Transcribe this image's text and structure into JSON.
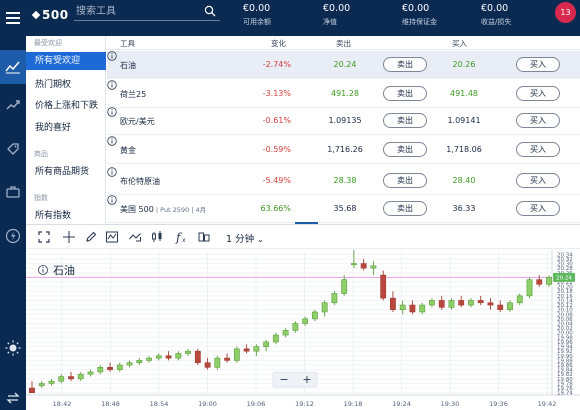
{
  "topbar": {
    "brand": "500",
    "search_placeholder": "搜索工具",
    "stats": [
      {
        "value": "€0.00",
        "label": "可用余额"
      },
      {
        "value": "€0.00",
        "label": "净值"
      },
      {
        "value": "€0.00",
        "label": "维持保证金"
      },
      {
        "value": "€0.00",
        "label": "收益/损失"
      }
    ],
    "avatar": "13"
  },
  "categories": {
    "group1": "最受欢迎",
    "items1": [
      "所有受欢迎",
      "热门期权",
      "价格上涨和下跌",
      "我的喜好"
    ],
    "group2": "商品",
    "items2": [
      "所有商品期货"
    ],
    "group3": "指数",
    "items3": [
      "所有指数"
    ]
  },
  "table": {
    "headers": {
      "tool": "工具",
      "change": "变化",
      "sell": "卖出",
      "buy": "买入"
    },
    "sell_label": "卖出",
    "buy_label": "买入",
    "rows": [
      {
        "name": "石油",
        "sub": "",
        "change": "-2.74%",
        "sell": "20.24",
        "buy": "20.26",
        "trend": "neg",
        "price_color": "pos"
      },
      {
        "name": "荷兰25",
        "sub": "",
        "change": "-3.13%",
        "sell": "491.28",
        "buy": "491.48",
        "trend": "neg",
        "price_color": "pos"
      },
      {
        "name": "欧元/美元",
        "sub": "",
        "change": "-0.61%",
        "sell": "1.09135",
        "buy": "1.09141",
        "trend": "neg",
        "price_color": "none"
      },
      {
        "name": "黄金",
        "sub": "",
        "change": "-0.59%",
        "sell": "1,716.26",
        "buy": "1,718.06",
        "trend": "neg",
        "price_color": "none"
      },
      {
        "name": "布伦特原油",
        "sub": "",
        "change": "-5.49%",
        "sell": "28.38",
        "buy": "28.40",
        "trend": "neg",
        "price_color": "pos"
      },
      {
        "name": "美国 500",
        "sub": " | Put 2590 | 4月",
        "change": "63.66%",
        "sell": "35.68",
        "buy": "36.33",
        "trend": "pos",
        "price_color": "none"
      }
    ]
  },
  "chart_toolbar": {
    "timeframe": "1 分钟"
  },
  "chart_data": {
    "type": "candlestick",
    "title": "石油",
    "last_price": "20.24",
    "x_ticks": [
      "18:42",
      "18:48",
      "18:54",
      "19:00",
      "19:06",
      "19:12",
      "19:18",
      "19:24",
      "19:30",
      "19:36",
      "19:42"
    ],
    "y_ticks": [
      "20.34",
      "20.32",
      "20.30",
      "20.28",
      "20.26",
      "20.24",
      "20.22",
      "20.20",
      "20.18",
      "20.16",
      "20.14",
      "20.12",
      "20.10",
      "20.08",
      "20.06",
      "20.04",
      "20.02",
      "20.00",
      "19.98",
      "19.96",
      "19.94",
      "19.92",
      "19.90",
      "19.88",
      "19.86",
      "19.84",
      "19.82",
      "19.80",
      "19.78",
      "19.76",
      "19.74"
    ],
    "ylim": [
      19.73,
      20.35
    ],
    "candles": [
      {
        "o": 19.76,
        "h": 19.79,
        "l": 19.74,
        "c": 19.74
      },
      {
        "o": 19.77,
        "h": 19.79,
        "l": 19.76,
        "c": 19.78
      },
      {
        "o": 19.78,
        "h": 19.8,
        "l": 19.77,
        "c": 19.79
      },
      {
        "o": 19.79,
        "h": 19.82,
        "l": 19.78,
        "c": 19.81
      },
      {
        "o": 19.81,
        "h": 19.83,
        "l": 19.79,
        "c": 19.8
      },
      {
        "o": 19.8,
        "h": 19.83,
        "l": 19.79,
        "c": 19.82
      },
      {
        "o": 19.82,
        "h": 19.84,
        "l": 19.81,
        "c": 19.83
      },
      {
        "o": 19.83,
        "h": 19.86,
        "l": 19.82,
        "c": 19.85
      },
      {
        "o": 19.85,
        "h": 19.87,
        "l": 19.83,
        "c": 19.84
      },
      {
        "o": 19.84,
        "h": 19.87,
        "l": 19.83,
        "c": 19.86
      },
      {
        "o": 19.86,
        "h": 19.88,
        "l": 19.85,
        "c": 19.87
      },
      {
        "o": 19.87,
        "h": 19.89,
        "l": 19.86,
        "c": 19.88
      },
      {
        "o": 19.88,
        "h": 19.9,
        "l": 19.87,
        "c": 19.89
      },
      {
        "o": 19.89,
        "h": 19.91,
        "l": 19.88,
        "c": 19.9
      },
      {
        "o": 19.9,
        "h": 19.92,
        "l": 19.88,
        "c": 19.89
      },
      {
        "o": 19.89,
        "h": 19.92,
        "l": 19.88,
        "c": 19.91
      },
      {
        "o": 19.91,
        "h": 19.93,
        "l": 19.9,
        "c": 19.92
      },
      {
        "o": 19.92,
        "h": 19.93,
        "l": 19.86,
        "c": 19.87
      },
      {
        "o": 19.87,
        "h": 19.89,
        "l": 19.84,
        "c": 19.85
      },
      {
        "o": 19.85,
        "h": 19.9,
        "l": 19.84,
        "c": 19.89
      },
      {
        "o": 19.89,
        "h": 19.91,
        "l": 19.87,
        "c": 19.88
      },
      {
        "o": 19.88,
        "h": 19.94,
        "l": 19.87,
        "c": 19.93
      },
      {
        "o": 19.93,
        "h": 19.95,
        "l": 19.91,
        "c": 19.92
      },
      {
        "o": 19.92,
        "h": 19.95,
        "l": 19.9,
        "c": 19.94
      },
      {
        "o": 19.94,
        "h": 19.97,
        "l": 19.92,
        "c": 19.96
      },
      {
        "o": 19.96,
        "h": 20.0,
        "l": 19.95,
        "c": 19.99
      },
      {
        "o": 19.99,
        "h": 20.02,
        "l": 19.98,
        "c": 20.01
      },
      {
        "o": 20.01,
        "h": 20.05,
        "l": 20.0,
        "c": 20.04
      },
      {
        "o": 20.04,
        "h": 20.07,
        "l": 20.03,
        "c": 20.06
      },
      {
        "o": 20.06,
        "h": 20.1,
        "l": 20.05,
        "c": 20.09
      },
      {
        "o": 20.09,
        "h": 20.14,
        "l": 20.07,
        "c": 20.13
      },
      {
        "o": 20.13,
        "h": 20.18,
        "l": 20.12,
        "c": 20.17
      },
      {
        "o": 20.17,
        "h": 20.25,
        "l": 20.16,
        "c": 20.23
      },
      {
        "o": 20.3,
        "h": 20.36,
        "l": 20.28,
        "c": 20.3
      },
      {
        "o": 20.3,
        "h": 20.32,
        "l": 20.27,
        "c": 20.28
      },
      {
        "o": 20.28,
        "h": 20.31,
        "l": 20.25,
        "c": 20.29
      },
      {
        "o": 20.25,
        "h": 20.27,
        "l": 20.14,
        "c": 20.15
      },
      {
        "o": 20.15,
        "h": 20.18,
        "l": 20.09,
        "c": 20.1
      },
      {
        "o": 20.1,
        "h": 20.14,
        "l": 20.08,
        "c": 20.12
      },
      {
        "o": 20.12,
        "h": 20.14,
        "l": 20.08,
        "c": 20.09
      },
      {
        "o": 20.09,
        "h": 20.13,
        "l": 20.08,
        "c": 20.12
      },
      {
        "o": 20.12,
        "h": 20.15,
        "l": 20.11,
        "c": 20.14
      },
      {
        "o": 20.14,
        "h": 20.16,
        "l": 20.1,
        "c": 20.11
      },
      {
        "o": 20.11,
        "h": 20.15,
        "l": 20.1,
        "c": 20.14
      },
      {
        "o": 20.14,
        "h": 20.16,
        "l": 20.11,
        "c": 20.12
      },
      {
        "o": 20.12,
        "h": 20.15,
        "l": 20.11,
        "c": 20.14
      },
      {
        "o": 20.14,
        "h": 20.16,
        "l": 20.12,
        "c": 20.13
      },
      {
        "o": 20.13,
        "h": 20.15,
        "l": 20.1,
        "c": 20.12
      },
      {
        "o": 20.12,
        "h": 20.14,
        "l": 20.09,
        "c": 20.1
      },
      {
        "o": 20.1,
        "h": 20.14,
        "l": 20.09,
        "c": 20.13
      },
      {
        "o": 20.13,
        "h": 20.17,
        "l": 20.12,
        "c": 20.16
      },
      {
        "o": 20.16,
        "h": 20.24,
        "l": 20.15,
        "c": 20.23
      },
      {
        "o": 20.23,
        "h": 20.25,
        "l": 20.2,
        "c": 20.21
      },
      {
        "o": 20.21,
        "h": 20.25,
        "l": 20.2,
        "c": 20.24
      }
    ]
  }
}
